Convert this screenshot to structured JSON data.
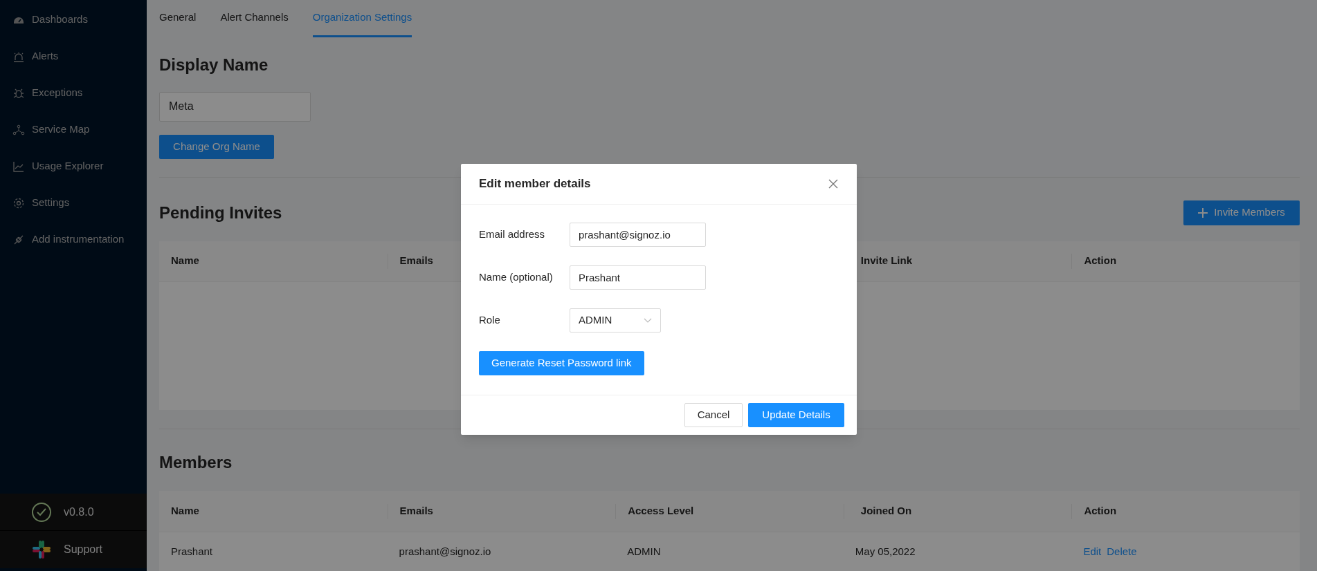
{
  "sidebar": {
    "items": [
      {
        "label": "Dashboards"
      },
      {
        "label": "Alerts"
      },
      {
        "label": "Exceptions"
      },
      {
        "label": "Service Map"
      },
      {
        "label": "Usage Explorer"
      },
      {
        "label": "Settings"
      },
      {
        "label": "Add instrumentation"
      }
    ],
    "version": "v0.8.0",
    "support": "Support"
  },
  "tabs": [
    {
      "label": "General",
      "selected": false
    },
    {
      "label": "Alert Channels",
      "selected": false
    },
    {
      "label": "Organization Settings",
      "selected": true
    }
  ],
  "display_name": {
    "title": "Display Name",
    "value": "Meta",
    "button": "Change Org Name"
  },
  "pending_invites": {
    "title": "Pending Invites",
    "button": "Invite Members",
    "columns": [
      "Name",
      "Emails",
      null,
      "Invite Link",
      "Action"
    ]
  },
  "members": {
    "title": "Members",
    "columns": [
      "Name",
      "Emails",
      "Access Level",
      "Joined On",
      "Action"
    ],
    "rows": [
      {
        "name": "Prashant",
        "email": "prashant@signoz.io",
        "access": "ADMIN",
        "joined": "May 05,2022",
        "actions": [
          "Edit",
          "Delete"
        ]
      }
    ]
  },
  "modal": {
    "title": "Edit member details",
    "fields": [
      {
        "kind": "text",
        "label": "Email address",
        "value": "prashant@signoz.io"
      },
      {
        "kind": "text",
        "label": "Name (optional)",
        "value": "Prashant"
      },
      {
        "kind": "select",
        "label": "Role",
        "value": "ADMIN"
      }
    ],
    "reset_button": "Generate Reset Password link",
    "cancel": "Cancel",
    "submit": "Update Details"
  }
}
